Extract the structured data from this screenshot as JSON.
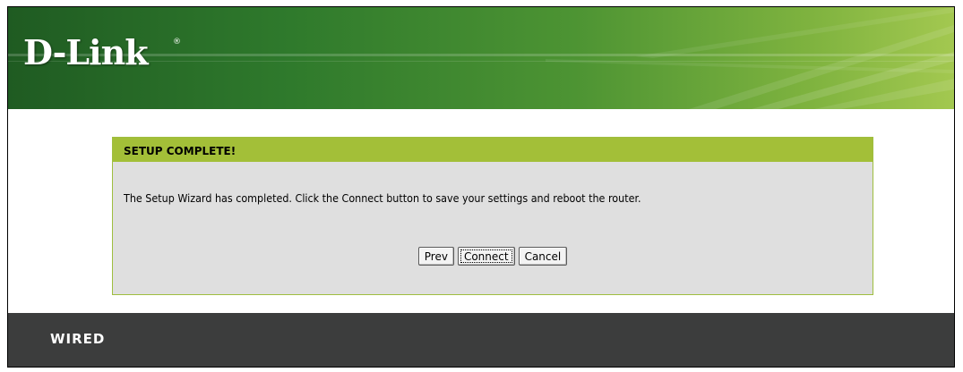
{
  "brand": {
    "logo_text": "D-Link",
    "logo_mark": "®"
  },
  "wizard": {
    "title": "SETUP COMPLETE!",
    "message": "The Setup Wizard has completed. Click the Connect button to save your settings and reboot the router.",
    "buttons": {
      "prev": "Prev",
      "connect": "Connect",
      "cancel": "Cancel"
    }
  },
  "footer": {
    "label": "WIRED"
  },
  "colors": {
    "banner_dark": "#1f5b22",
    "banner_light": "#a3c850",
    "panel_title": "#a3bf38",
    "panel_body": "#dfdfdf",
    "footer": "#3c3d3d"
  }
}
